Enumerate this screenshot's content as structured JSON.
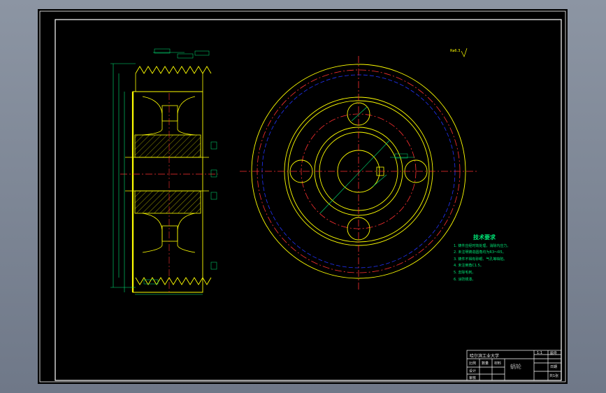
{
  "drawing": {
    "roughness_label": "Ra6.3",
    "technical_requirements": {
      "title": "技术要求",
      "items": [
        "1. 铸件应经时效处理，消除内应力。",
        "2. 未注明铸造圆角均为R3～R5。",
        "3. 铸件不得有砂眼、气孔等缺陷。",
        "4. 未注倒角C1.5。",
        "5. 去除毛刺。",
        "6. 涂防锈漆。"
      ]
    },
    "title_block": {
      "school": "哈尔滨工业大学",
      "part_name": "蜗轮",
      "scale": "1:1",
      "cells": [
        "比例",
        "数量",
        "材料",
        "图号",
        "设计",
        "审核",
        "日期",
        "共1张"
      ]
    },
    "colors": {
      "outline": "#ffff00",
      "center": "#ff3030",
      "pitch": "#2233ff",
      "dimension": "#00e676",
      "hatch": "#ffff00",
      "frame": "#ffffff"
    }
  }
}
